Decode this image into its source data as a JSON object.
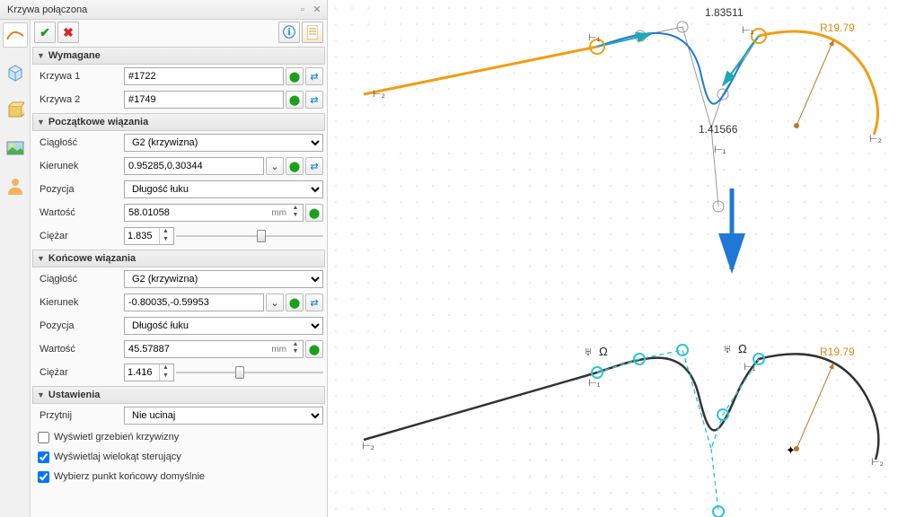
{
  "title": "Krzywa połączona",
  "sections": {
    "required": "Wymagane",
    "start": "Początkowe wiązania",
    "end": "Końcowe wiązania",
    "settings": "Ustawienia"
  },
  "labels": {
    "curve1": "Krzywa 1",
    "curve2": "Krzywa 2",
    "continuity": "Ciągłość",
    "direction": "Kierunek",
    "position": "Pozycja",
    "value": "Wartość",
    "weight": "Ciężar",
    "trim": "Przytnij"
  },
  "values": {
    "curve1": "#1722",
    "curve2": "#1749",
    "start": {
      "continuity": "G2 (krzywizna)",
      "direction": "0.95285,0.30344",
      "position": "Długość łuku",
      "value": "58.01058",
      "unit": "mm",
      "weight": "1.835"
    },
    "end": {
      "continuity": "G2 (krzywizna)",
      "direction": "-0.80035,-0.59953",
      "position": "Długość łuku",
      "value": "45.57887",
      "unit": "mm",
      "weight": "1.416"
    },
    "trim": "Nie ucinaj"
  },
  "checks": {
    "comb": "Wyświetl grzebień krzywizny",
    "poly": "Wyświetlaj wielokąt sterujący",
    "endpt": "Wybierz punkt końcowy domyślnie"
  },
  "canvas": {
    "dim1": "1.83511",
    "dim2": "1.41566",
    "radius": "R19.79",
    "mrk_t1": "⊢₁",
    "mrk_t2": "⊢₂",
    "sym_ctrl": "♅",
    "sym_omega": "Ω"
  }
}
